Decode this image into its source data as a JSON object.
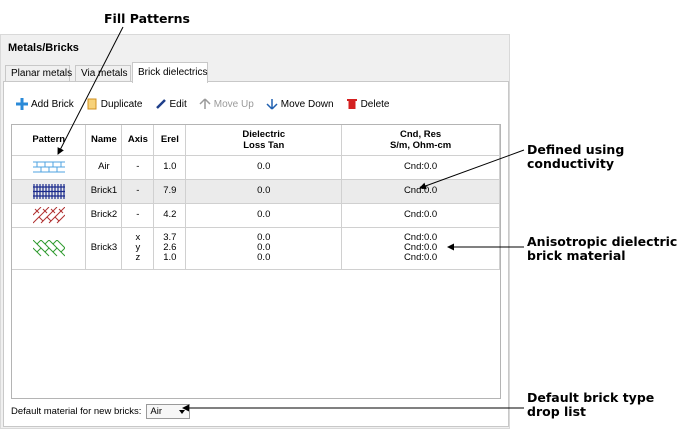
{
  "callouts": {
    "fill_patterns": "Fill Patterns",
    "defined_conductivity": "Defined using conductivity",
    "anisotropic_line1": "Anisotropic dielectric",
    "anisotropic_line2": "brick material",
    "default_line1": "Default brick type",
    "default_line2": "drop list"
  },
  "panel": {
    "title": "Metals/Bricks",
    "tabs": [
      "Planar metals",
      "Via metals",
      "Brick dielectrics"
    ],
    "active_tab": "Brick dielectrics"
  },
  "toolbar": {
    "add": "Add Brick",
    "duplicate": "Duplicate",
    "edit": "Edit",
    "move_up": "Move Up",
    "move_down": "Move Down",
    "delete": "Delete"
  },
  "table": {
    "headers": {
      "pattern": "Pattern",
      "name": "Name",
      "axis": "Axis",
      "erel": "Erel",
      "dielectric_1": "Dielectric",
      "dielectric_2": "Loss Tan",
      "cnd_1": "Cnd, Res",
      "cnd_2": "S/m, Ohm-cm"
    },
    "rows": [
      {
        "name": "Air",
        "axis": "-",
        "erel": "1.0",
        "loss": "0.0",
        "cnd": "Cnd:0.0"
      },
      {
        "name": "Brick1",
        "axis": "-",
        "erel": "7.9",
        "loss": "0.0",
        "cnd": "Cnd:0.0"
      },
      {
        "name": "Brick2",
        "axis": "-",
        "erel": "4.2",
        "loss": "0.0",
        "cnd": "Cnd:0.0"
      },
      {
        "name": "Brick3",
        "axis": [
          "x",
          "y",
          "z"
        ],
        "erel": [
          "3.7",
          "2.6",
          "1.0"
        ],
        "loss": [
          "0.0",
          "0.0",
          "0.0"
        ],
        "cnd": [
          "Cnd:0.0",
          "Cnd:0.0",
          "Cnd:0.0"
        ]
      }
    ]
  },
  "footer": {
    "label": "Default material for new bricks:",
    "selected": "Air"
  },
  "colors": {
    "air_pattern": "#4fa3e0",
    "brick1_pattern": "#1a2a8c",
    "brick2_pattern": "#b03030",
    "brick3_pattern": "#2e9a2e",
    "delete_icon": "#d42020",
    "add_icon": "#2a8ad8",
    "duplicate_icon": "#f0b030"
  }
}
